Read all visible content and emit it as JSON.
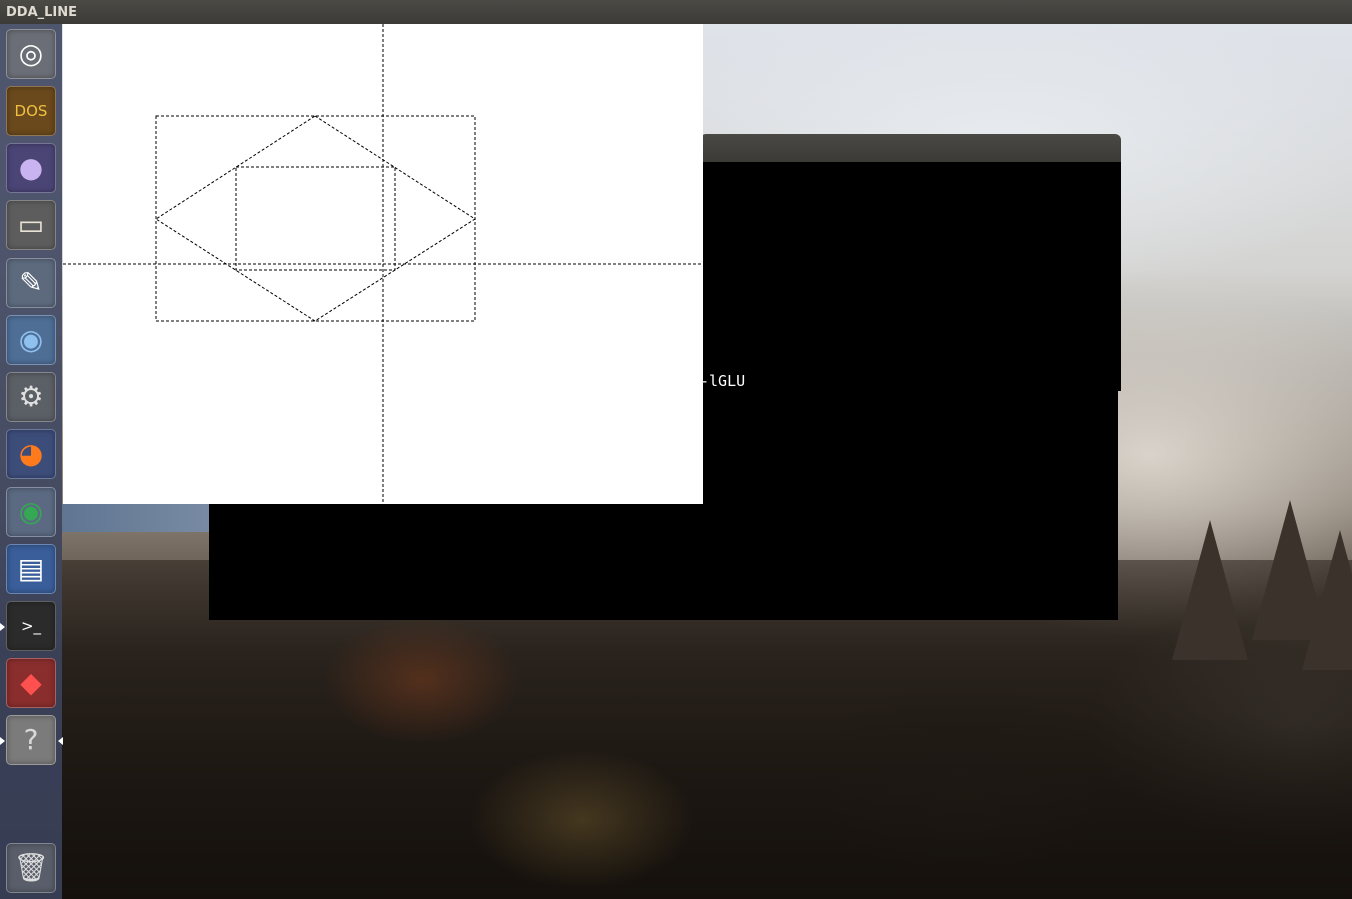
{
  "top_panel": {
    "title": "DDA_LINE"
  },
  "launcher": {
    "items": [
      {
        "name": "ubuntu-dash-icon",
        "glyph": "◎",
        "bg": "#6b6e76",
        "color": "#ffffff"
      },
      {
        "name": "dosbox-icon",
        "glyph": "DOS",
        "bg": "#6a4a1c",
        "color": "#f0c040"
      },
      {
        "name": "eclipse-icon",
        "glyph": "●",
        "bg": "#4b4576",
        "color": "#c9b3f0"
      },
      {
        "name": "files-icon",
        "glyph": "▭",
        "bg": "#5d5d5d",
        "color": "#e9e2d6"
      },
      {
        "name": "text-editor-icon",
        "glyph": "✎",
        "bg": "#5d6a7e",
        "color": "#ffffff"
      },
      {
        "name": "chromium-icon",
        "glyph": "◉",
        "bg": "#4e6e96",
        "color": "#8ec0f0"
      },
      {
        "name": "system-settings-icon",
        "glyph": "⚙",
        "bg": "#5b5f66",
        "color": "#e0e0e0"
      },
      {
        "name": "firefox-icon",
        "glyph": "◕",
        "bg": "#3d4d7a",
        "color": "#ff7a1a"
      },
      {
        "name": "chrome-icon",
        "glyph": "◉",
        "bg": "#5b6a82",
        "color": "#34a853"
      },
      {
        "name": "libreoffice-writer-icon",
        "glyph": "▤",
        "bg": "#3a5e9a",
        "color": "#ffffff"
      },
      {
        "name": "terminal-icon",
        "glyph": ">_",
        "bg": "#2b2b2b",
        "color": "#ffffff"
      },
      {
        "name": "app-red-icon",
        "glyph": "◆",
        "bg": "#8a2d2d",
        "color": "#ff5050"
      },
      {
        "name": "help-icon",
        "glyph": "?",
        "bg": "#7b7b7b",
        "color": "#d8d8d8"
      }
    ],
    "trash": {
      "name": "trash-icon",
      "glyph": "🗑",
      "bg": "#595e6a",
      "color": "#dedede"
    }
  },
  "terminal": {
    "visible_text": "-lGLU"
  },
  "gl_window": {
    "background": "#ffffff",
    "line_color": "#000000"
  }
}
